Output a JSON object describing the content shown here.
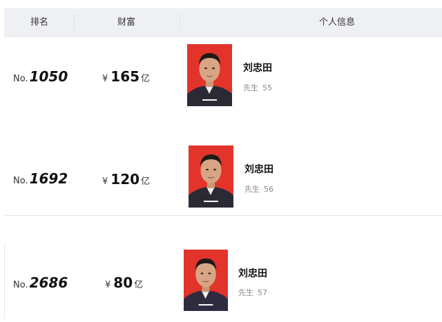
{
  "header": {
    "col_rank": "排名",
    "col_wealth": "财富",
    "col_info": "个人信息"
  },
  "rows": [
    {
      "rank_prefix": "No.",
      "rank": "1050",
      "currency": "¥",
      "wealth": "165",
      "unit": "亿",
      "name": "刘忠田",
      "title": "先生",
      "age": "55"
    },
    {
      "rank_prefix": "No.",
      "rank": "1692",
      "currency": "¥",
      "wealth": "120",
      "unit": "亿",
      "name": "刘忠田",
      "title": "先生",
      "age": "56"
    },
    {
      "rank_prefix": "No.",
      "rank": "2686",
      "currency": "¥",
      "wealth": "80",
      "unit": "亿",
      "name": "刘忠田",
      "title": "先生",
      "age": "57"
    }
  ],
  "colors": {
    "header_bg": "#eef0f3",
    "photo_bg": "#e2342b"
  }
}
